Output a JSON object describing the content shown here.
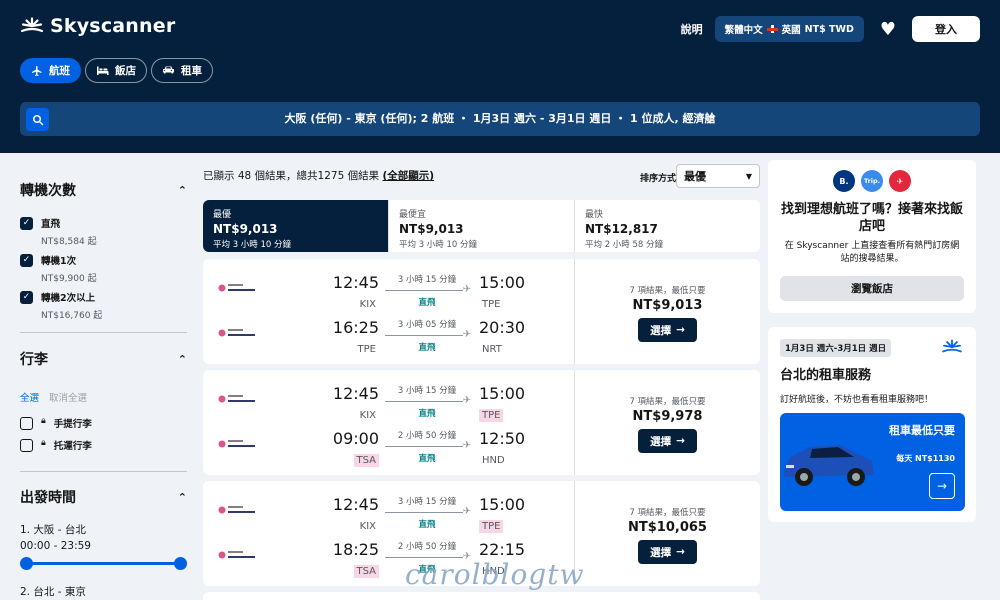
{
  "brand": {
    "name": "Skyscanner"
  },
  "nav": {
    "help": "說明",
    "locale_lang": "繁體中文",
    "locale_region": "英國",
    "locale_currency": "NT$ TWD",
    "login": "登入"
  },
  "tabs": [
    {
      "label": "航班",
      "icon": "plane-icon",
      "active": true
    },
    {
      "label": "飯店",
      "icon": "bed-icon",
      "active": false
    },
    {
      "label": "租車",
      "icon": "car-icon",
      "active": false
    }
  ],
  "search": {
    "summary": "大阪 (任何) - 東京 (任何); 2 航班 ・ 1月3日 週六 - 3月1日 週日 ・ 1 位成人, 經濟艙"
  },
  "filters": {
    "stops": {
      "title": "轉機次數",
      "options": [
        {
          "label": "直飛",
          "price": "NT$8,584 起",
          "checked": true
        },
        {
          "label": "轉機1次",
          "price": "NT$9,900 起",
          "checked": true
        },
        {
          "label": "轉機2次以上",
          "price": "NT$16,760 起",
          "checked": true
        }
      ]
    },
    "baggage": {
      "title": "行李",
      "select_all": "全選",
      "clear_all": "取消全選",
      "options": [
        {
          "label": "手提行李"
        },
        {
          "label": "托運行李"
        }
      ]
    },
    "departure": {
      "title": "出發時間",
      "leg1_label": "1. 大阪 - 台北",
      "leg1_range": "00:00 - 23:59",
      "leg2_label": "2. 台北 - 東京"
    }
  },
  "results": {
    "shown": "已顯示 48 個結果，總共1275 個結果",
    "show_all": "(全部顯示)",
    "sort_label": "排序方式",
    "sort_value": "最優"
  },
  "sort_tabs": [
    {
      "name": "最優",
      "price": "NT$9,013",
      "duration": "平均 3 小時 10 分鐘",
      "active": true
    },
    {
      "name": "最便宜",
      "price": "NT$9,013",
      "duration": "平均 3 小時 10 分鐘",
      "active": false
    },
    {
      "name": "最快",
      "price": "NT$12,817",
      "duration": "平均 2 小時 58 分鐘",
      "active": false
    }
  ],
  "flights": [
    {
      "legs": [
        {
          "dep_time": "12:45",
          "dep_code": "KIX",
          "duration": "3 小時 15 分鐘",
          "stops": "直飛",
          "arr_time": "15:00",
          "arr_code": "TPE"
        },
        {
          "dep_time": "16:25",
          "dep_code": "TPE",
          "duration": "3 小時 05 分鐘",
          "stops": "直飛",
          "arr_time": "20:30",
          "arr_code": "NRT"
        }
      ],
      "deals": "7 項結果，最低只要",
      "price": "NT$9,013",
      "select": "選擇"
    },
    {
      "legs": [
        {
          "dep_time": "12:45",
          "dep_code": "KIX",
          "duration": "3 小時 15 分鐘",
          "stops": "直飛",
          "arr_time": "15:00",
          "arr_code": "TPE"
        },
        {
          "dep_time": "09:00",
          "dep_code": "TSA",
          "duration": "2 小時 50 分鐘",
          "stops": "直飛",
          "arr_time": "12:50",
          "arr_code": "HND"
        }
      ],
      "deals": "7 項結果，最低只要",
      "price": "NT$9,978",
      "select": "選擇"
    },
    {
      "legs": [
        {
          "dep_time": "12:45",
          "dep_code": "KIX",
          "duration": "3 小時 15 分鐘",
          "stops": "直飛",
          "arr_time": "15:00",
          "arr_code": "TPE"
        },
        {
          "dep_time": "18:25",
          "dep_code": "TSA",
          "duration": "2 小時 50 分鐘",
          "stops": "直飛",
          "arr_time": "22:15",
          "arr_code": "HND"
        }
      ],
      "deals": "7 項結果，最低只要",
      "price": "NT$10,065",
      "select": "選擇"
    }
  ],
  "hotel_promo": {
    "badges": [
      "B.",
      "Trip.",
      "✈"
    ],
    "title": "找到理想航班了嗎？接著來找飯店吧",
    "desc": "在 Skyscanner 上直接查看所有熱門訂房網站的搜尋結果。",
    "button": "瀏覽飯店"
  },
  "car_promo": {
    "dates": "1月3日 週六-3月1日 週日",
    "title": "台北的租車服務",
    "desc": "訂好航班後，不妨也看看租車服務吧！",
    "offer": "租車最低只要",
    "price": "每天 NT$1130"
  },
  "watermark": "carolblogtw"
}
